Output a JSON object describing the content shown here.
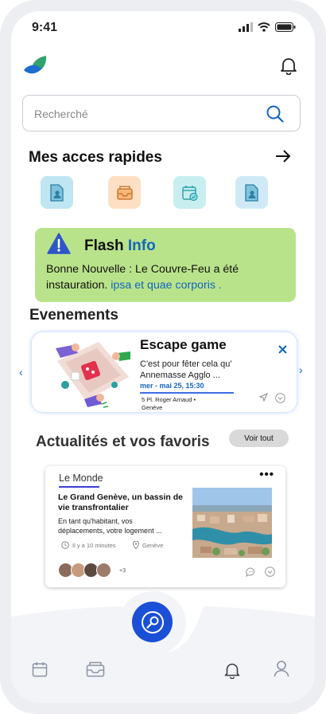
{
  "status": {
    "time": "9:41"
  },
  "search": {
    "placeholder": "Recherché"
  },
  "quick_access": {
    "title": "Mes acces rapides",
    "tiles": [
      {
        "icon": "user-file-icon",
        "color": "#bfe6f2"
      },
      {
        "icon": "inbox-icon",
        "color": "#fde0c4"
      },
      {
        "icon": "calendar-check-icon",
        "color": "#c8eef0"
      },
      {
        "icon": "user-file-icon",
        "color": "#cfeaf6"
      }
    ]
  },
  "flash": {
    "title_a": "Flash",
    "title_b": "Info",
    "body": "Bonne Nouvelle : Le Couvre-Feu a été instauration.",
    "link": "ipsa et quae corporis ."
  },
  "events": {
    "title": "Evenements",
    "card": {
      "name": "Escape game",
      "description": "C'est pour fêter cela qu' Annemasse Agglo ...",
      "date": "mer - mai 25, 15:30",
      "address_line1": "5 Pl. Roger Arnaud •",
      "address_line2": "Genève"
    }
  },
  "news": {
    "title": "Actualités et vos favoris",
    "see_all": "Voir tout",
    "card": {
      "source": "Le Monde",
      "headline": "Le Grand Genève, un bassin de vie transfrontalier",
      "excerpt": "En tant qu'habitant, vos déplacements, votre logement ...",
      "time": "Il y a 10 minutes",
      "location": "Genève",
      "more_count": "+3"
    }
  },
  "colors": {
    "accent": "#1a4fd6",
    "link": "#1565c0",
    "flash_bg": "#b9e38a"
  },
  "nav": {
    "items": [
      "calendar-icon",
      "inbox-icon",
      "bell-icon",
      "user-icon"
    ]
  }
}
